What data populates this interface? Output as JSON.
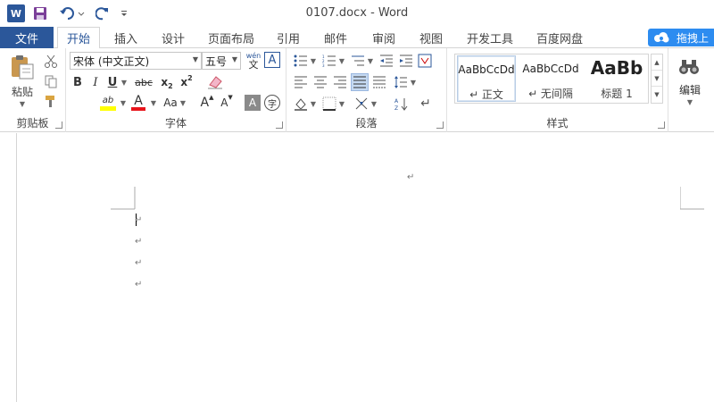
{
  "window": {
    "title": "0107.docx - Word",
    "app_logo": "W"
  },
  "quick_access": {
    "icons": [
      "save-icon",
      "undo-icon",
      "redo-icon",
      "customize-qat-icon"
    ]
  },
  "tabs": {
    "file": "文件",
    "items": [
      "开始",
      "插入",
      "设计",
      "页面布局",
      "引用",
      "邮件",
      "审阅",
      "视图",
      "开发工具",
      "百度网盘"
    ],
    "active": "开始"
  },
  "baidu": {
    "label": "拖拽上"
  },
  "clipboard": {
    "paste": "粘贴",
    "group_label": "剪贴板"
  },
  "font": {
    "font_name": "宋体 (中文正文)",
    "font_size": "五号",
    "wen_label": "wén",
    "wen_char": "文",
    "bold": "B",
    "italic": "I",
    "underline": "U",
    "strike": "abc",
    "subscript_base": "x",
    "subscript": "2",
    "superscript_base": "x",
    "superscript": "2",
    "highlight_label": "ab",
    "font_color_label": "A",
    "case_label": "Aa",
    "grow_label": "A",
    "shrink_label": "A",
    "shading_label": "A",
    "enclose_label": "字",
    "group_label": "字体",
    "highlight_color": "#ffff00",
    "font_color": "#e8141b"
  },
  "paragraph": {
    "group_label": "段落"
  },
  "styles": {
    "items": [
      {
        "sample": "AaBbCcDd",
        "name": "↵ 正文"
      },
      {
        "sample": "AaBbCcDd",
        "name": "↵ 无间隔"
      },
      {
        "sample": "AaBb",
        "name": "标题 1"
      }
    ],
    "group_label": "样式"
  },
  "editing": {
    "label": "编辑"
  },
  "document": {
    "paragraph_mark": "↵"
  },
  "colors": {
    "accent": "#2b579a",
    "baidu": "#2d8cf0",
    "annotation": "#e8141b"
  }
}
